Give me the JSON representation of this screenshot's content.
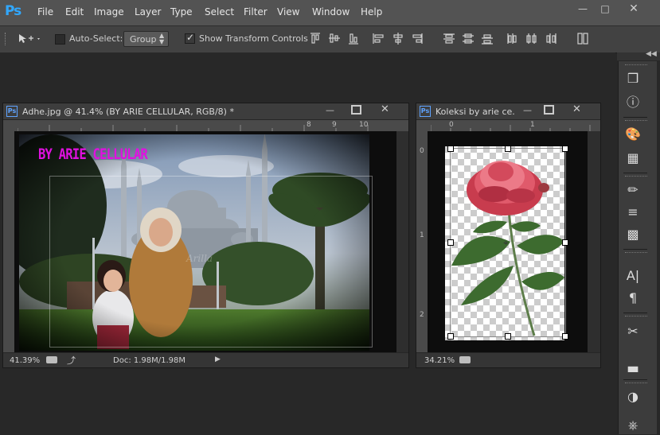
{
  "app": {
    "logo": "Ps"
  },
  "menu": [
    "File",
    "Edit",
    "Image",
    "Layer",
    "Type",
    "Select",
    "Filter",
    "View",
    "Window",
    "Help"
  ],
  "options": {
    "auto_select_label": "Auto-Select:",
    "auto_select_value": "Group",
    "show_transform_label": "Show Transform Controls",
    "show_transform_checked": true,
    "auto_select_checked": false
  },
  "doc1": {
    "title": "Adhe.jpg @ 41.4% (BY ARIE CELLULAR, RGB/8) *",
    "zoom": "41.39%",
    "doc_size": "Doc: 1.98M/1.98M",
    "overlay_text": "BY ARIE CELLULAR",
    "ruler_ticks": [
      "8",
      "9",
      "10"
    ]
  },
  "doc2": {
    "title": "Koleksi by arie ce...",
    "zoom": "34.21%",
    "ruler_top": [
      "0",
      "1"
    ],
    "ruler_left": [
      "0",
      "1",
      "2"
    ]
  },
  "colors": {
    "accent": "#31a8ff",
    "overlay_text": "#e010e0",
    "menubar": "#535353",
    "optionsbar": "#424242",
    "workspace": "#282828"
  },
  "dock_icons": [
    "3d-cube-icon",
    "info-icon",
    "palette-icon",
    "grid-icon",
    "brushes-icon",
    "brush-preset-icon",
    "clone-source-icon",
    "character-icon",
    "paragraph-icon",
    "tools-icon",
    "histogram-icon",
    "adjustments-icon",
    "navigator-icon"
  ]
}
